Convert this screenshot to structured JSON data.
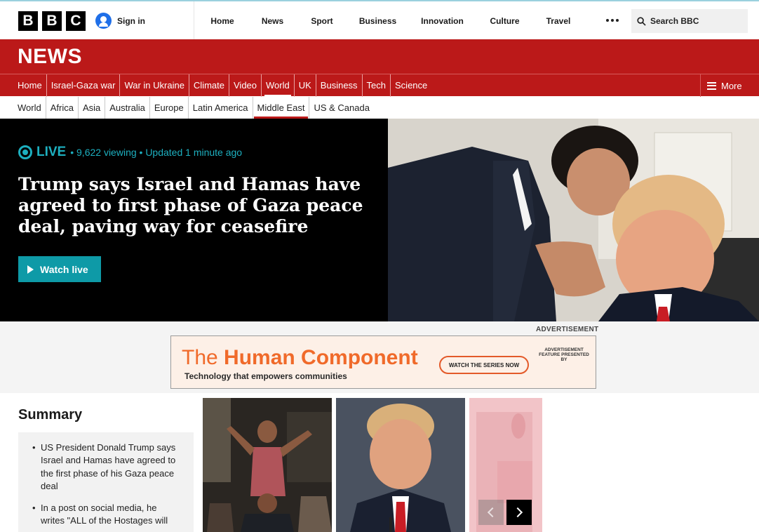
{
  "brand": {
    "letters": [
      "B",
      "B",
      "C"
    ],
    "color": "#000000"
  },
  "account": {
    "signin_label": "Sign in"
  },
  "topnav": [
    "Home",
    "News",
    "Sport",
    "Business",
    "Innovation",
    "Culture",
    "Travel"
  ],
  "search": {
    "placeholder": "Search BBC"
  },
  "news": {
    "title": "NEWS",
    "color": "#bb1919"
  },
  "section_nav": {
    "items": [
      "Home",
      "Israel-Gaza war",
      "War in Ukraine",
      "Climate",
      "Video",
      "World",
      "UK",
      "Business",
      "Tech",
      "Science"
    ],
    "active": "World",
    "more_label": "More"
  },
  "sub_nav": {
    "items": [
      "World",
      "Africa",
      "Asia",
      "Australia",
      "Europe",
      "Latin America",
      "Middle East",
      "US & Canada"
    ],
    "active": "Middle East"
  },
  "hero": {
    "live_label": "LIVE",
    "meta": "• 9,622 viewing • Updated 1 minute ago",
    "headline": "Trump says Israel and Hamas have agreed to first phase of Gaza peace deal, paving way for ceasefire",
    "watch_label": "Watch live",
    "accent": "#1dafbf"
  },
  "advert": {
    "label": "ADVERTISEMENT",
    "title_prefix": "The ",
    "title_bold": "Human Component",
    "tagline": "Technology that empowers communities",
    "cta": "WATCH THE SERIES NOW",
    "feature_note": "ADVERTISEMENT FEATURE PRESENTED BY"
  },
  "summary": {
    "title": "Summary",
    "bullets": [
      "US President Donald Trump says Israel and Hamas have agreed to the first phase of his Gaza peace deal",
      "In a post on social media, he writes \"ALL of the Hostages will"
    ]
  }
}
